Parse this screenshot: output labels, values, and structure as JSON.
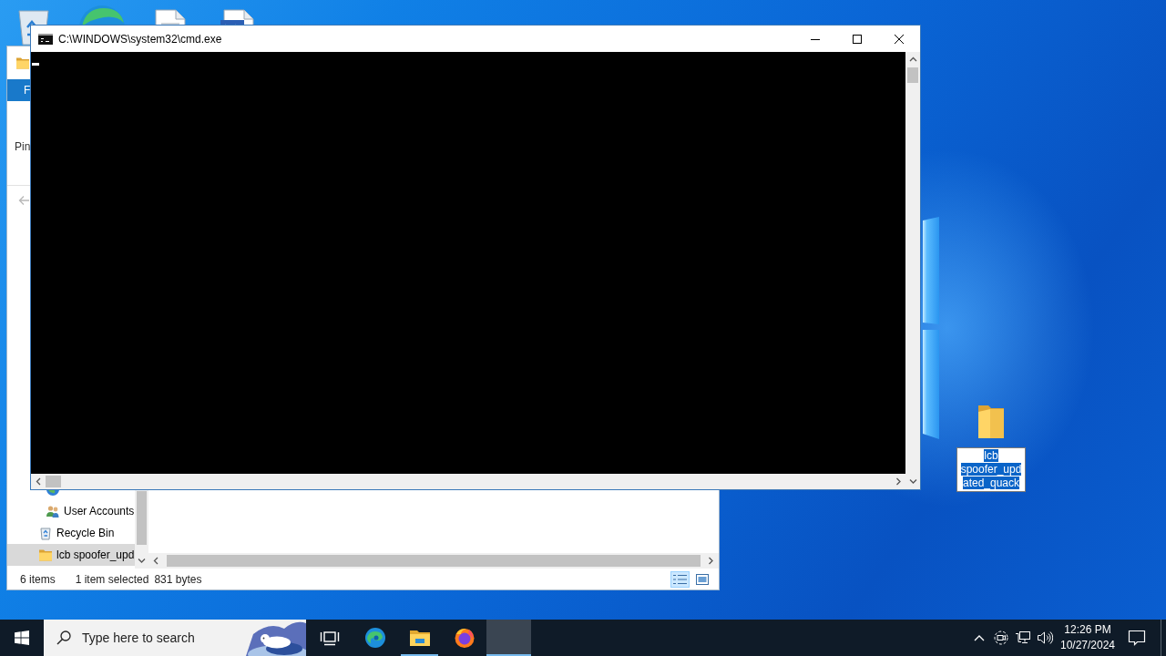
{
  "desktop": {
    "items": [
      {
        "label": "lcb spoofer_updated_quack",
        "selected": true
      }
    ]
  },
  "explorer": {
    "ribbon_tab": "F",
    "ribbon_label": "Pin",
    "nav_tree": [
      {
        "children": [
          {
            "kind": "users",
            "label": "User Accounts",
            "selected": false
          }
        ]
      },
      {
        "kind": "recycle-bin",
        "label": "Recycle Bin",
        "selected": false
      },
      {
        "kind": "folder",
        "label": "lcb spoofer_upd",
        "selected": true
      }
    ],
    "status_bar": {
      "item_count": "6 items",
      "selection": "1 item selected",
      "size": "831 bytes"
    },
    "views": [
      {
        "kind": "details",
        "selected": true
      },
      {
        "kind": "large-icons",
        "selected": false
      }
    ]
  },
  "console": {
    "title": "C:\\WINDOWS\\system32\\cmd.exe"
  },
  "taskbar": {
    "search": {
      "placeholder": "Type here to search"
    },
    "apps": [
      {
        "kind": "edge",
        "running": false,
        "selected": false
      },
      {
        "kind": "explorer",
        "running": true,
        "selected": false
      },
      {
        "kind": "firefox",
        "running": false,
        "selected": false
      },
      {
        "kind": "console",
        "running": true,
        "selected": true
      }
    ],
    "clock": {
      "time": "12:26 PM",
      "date": "10/27/2024"
    }
  }
}
